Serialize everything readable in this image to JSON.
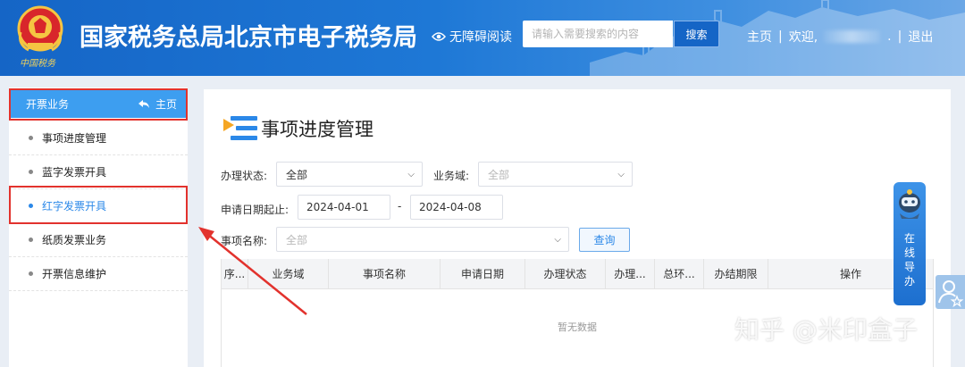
{
  "header": {
    "site_title": "国家税务总局北京市电子税务局",
    "emblem_text": "中国税务",
    "accessibility_label": "无障碍阅读",
    "search_placeholder": "请输入需要搜索的内容",
    "search_button": "搜索",
    "home_link": "主页",
    "welcome_text": "欢迎,",
    "welcome_suffix": ".",
    "logout_link": "退出"
  },
  "sidebar": {
    "section_title": "开票业务",
    "home_label": "主页",
    "items": [
      {
        "label": "事项进度管理"
      },
      {
        "label": "蓝字发票开具"
      },
      {
        "label": "红字发票开具"
      },
      {
        "label": "纸质发票业务"
      },
      {
        "label": "开票信息维护"
      }
    ]
  },
  "main": {
    "page_title": "事项进度管理",
    "filters": {
      "status_label": "办理状态:",
      "status_value": "全部",
      "domain_label": "业务域:",
      "domain_value": "全部",
      "date_label": "申请日期起止:",
      "date_start": "2024-04-01",
      "date_separator": "-",
      "date_end": "2024-04-08",
      "item_label": "事项名称:",
      "item_value": "全部",
      "query_button": "查询"
    },
    "table": {
      "columns": [
        "序...",
        "业务域",
        "事项名称",
        "申请日期",
        "办理状态",
        "办理...",
        "总环...",
        "办结期限",
        "操作"
      ],
      "empty_text": "暂无数据"
    }
  },
  "widgets": {
    "online_guide_text": "在线导办"
  },
  "watermark": "知乎 @米印盒子",
  "colors": {
    "header_blue": "#1565c6",
    "sidebar_active_bg": "#3d9ef0",
    "link_blue": "#2b88e8",
    "highlight_red": "#e2322d"
  }
}
